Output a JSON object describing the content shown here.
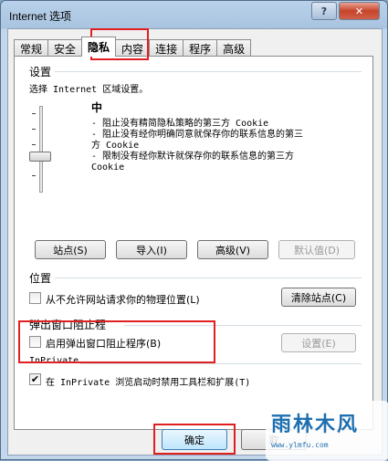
{
  "window": {
    "title": "Internet 选项",
    "help_label": "?",
    "close_label": "✕"
  },
  "tabs": [
    {
      "label": "常规"
    },
    {
      "label": "安全"
    },
    {
      "label": "隐私"
    },
    {
      "label": "内容"
    },
    {
      "label": "连接"
    },
    {
      "label": "程序"
    },
    {
      "label": "高级"
    }
  ],
  "settings": {
    "title": "设置",
    "instruction": "选择 Internet 区域设置。",
    "level": "中",
    "desc1": "- 阻止没有精简隐私策略的第三方 Cookie",
    "desc2a": "- 阻止没有经你明确同意就保存你的联系信息的第三",
    "desc2b": "方 Cookie",
    "desc3a": "- 限制没有经你默许就保存你的联系信息的第三方",
    "desc3b": "Cookie",
    "buttons": {
      "sites": "站点(S)",
      "import": "导入(I)",
      "advanced": "高级(V)",
      "default": "默认值(D)"
    }
  },
  "location": {
    "title": "位置",
    "never_allow": "从不允许网站请求你的物理位置(L)",
    "clear_sites": "清除站点(C)"
  },
  "popup": {
    "title": "弹出窗口阻止程",
    "enable": "启用弹出窗口阻止程序(B)",
    "settings": "设置(E)"
  },
  "inprivate": {
    "title": "InPrivate",
    "disable_toolbars": "在 InPrivate 浏览启动时禁用工具栏和扩展(T)",
    "checked": "✔"
  },
  "footer": {
    "ok": "确定",
    "cancel": "取"
  },
  "watermark": {
    "main": "雨林木风",
    "url": "www.ylmfu.com"
  }
}
